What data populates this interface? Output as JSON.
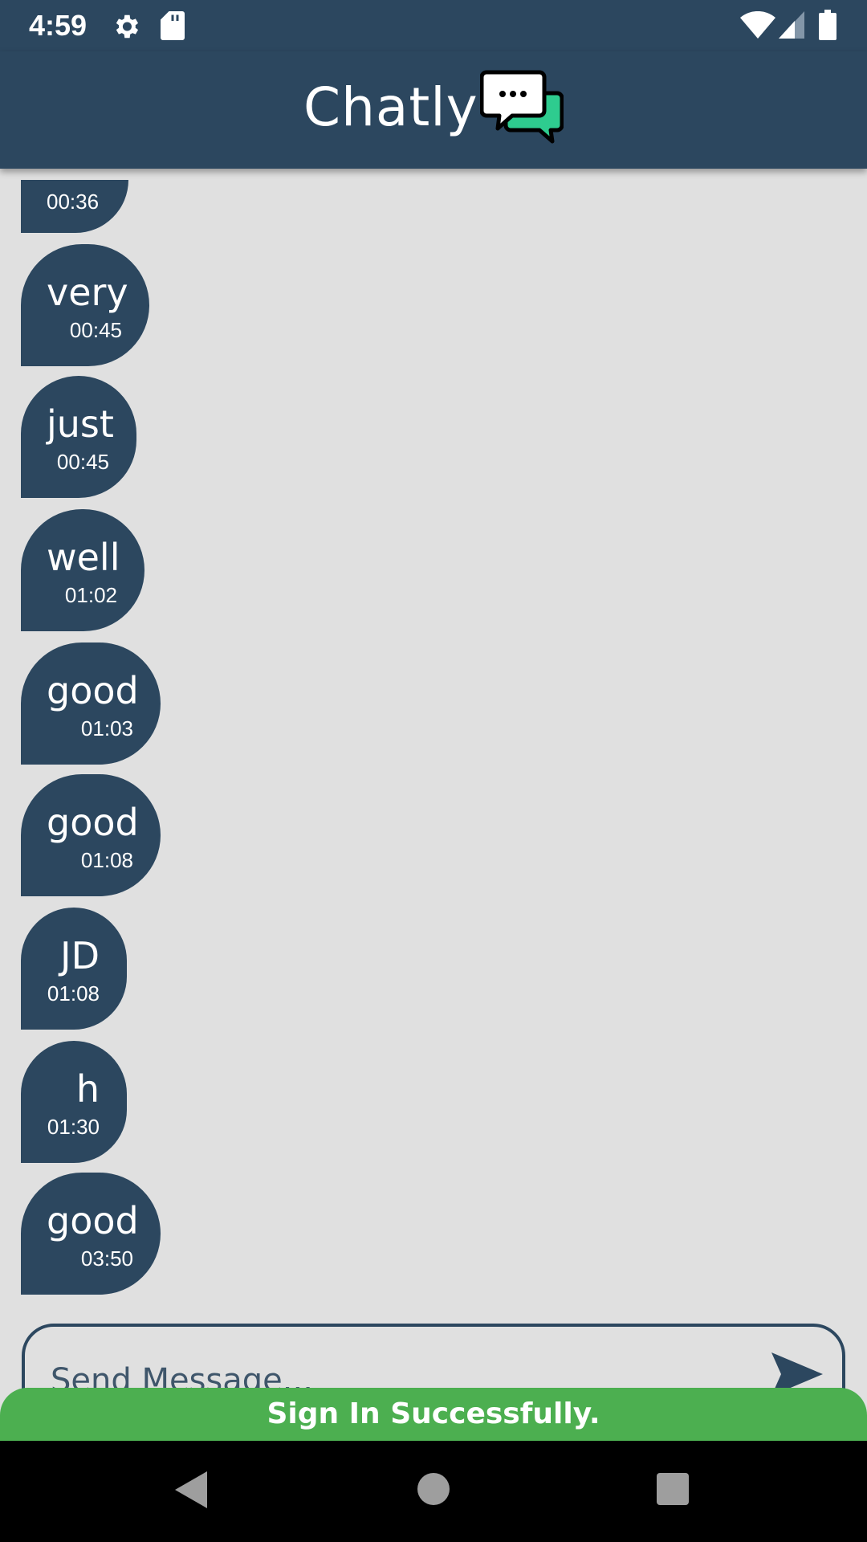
{
  "status_bar": {
    "time": "4:59",
    "icons": [
      "gear-icon",
      "sd-card-icon",
      "wifi-icon",
      "signal-icon",
      "battery-icon"
    ]
  },
  "app_bar": {
    "title": "Chatly",
    "logo_icon": "chat-bubbles-icon",
    "background": "#2c475f"
  },
  "messages": [
    {
      "text": "",
      "time": "00:36"
    },
    {
      "text": "very",
      "time": "00:45"
    },
    {
      "text": "just",
      "time": "00:45"
    },
    {
      "text": "well",
      "time": "01:02"
    },
    {
      "text": "good",
      "time": "01:03"
    },
    {
      "text": "good",
      "time": "01:08"
    },
    {
      "text": "JD",
      "time": "01:08"
    },
    {
      "text": "h",
      "time": "01:30"
    },
    {
      "text": "good",
      "time": "03:50"
    }
  ],
  "composer": {
    "placeholder": "Send Message...",
    "value": "",
    "send_icon": "send-icon"
  },
  "toast": {
    "text": "Sign In Successfully.",
    "color": "#4caf50"
  },
  "nav_bar": {
    "buttons": [
      "back-icon",
      "home-icon",
      "recents-icon"
    ]
  }
}
